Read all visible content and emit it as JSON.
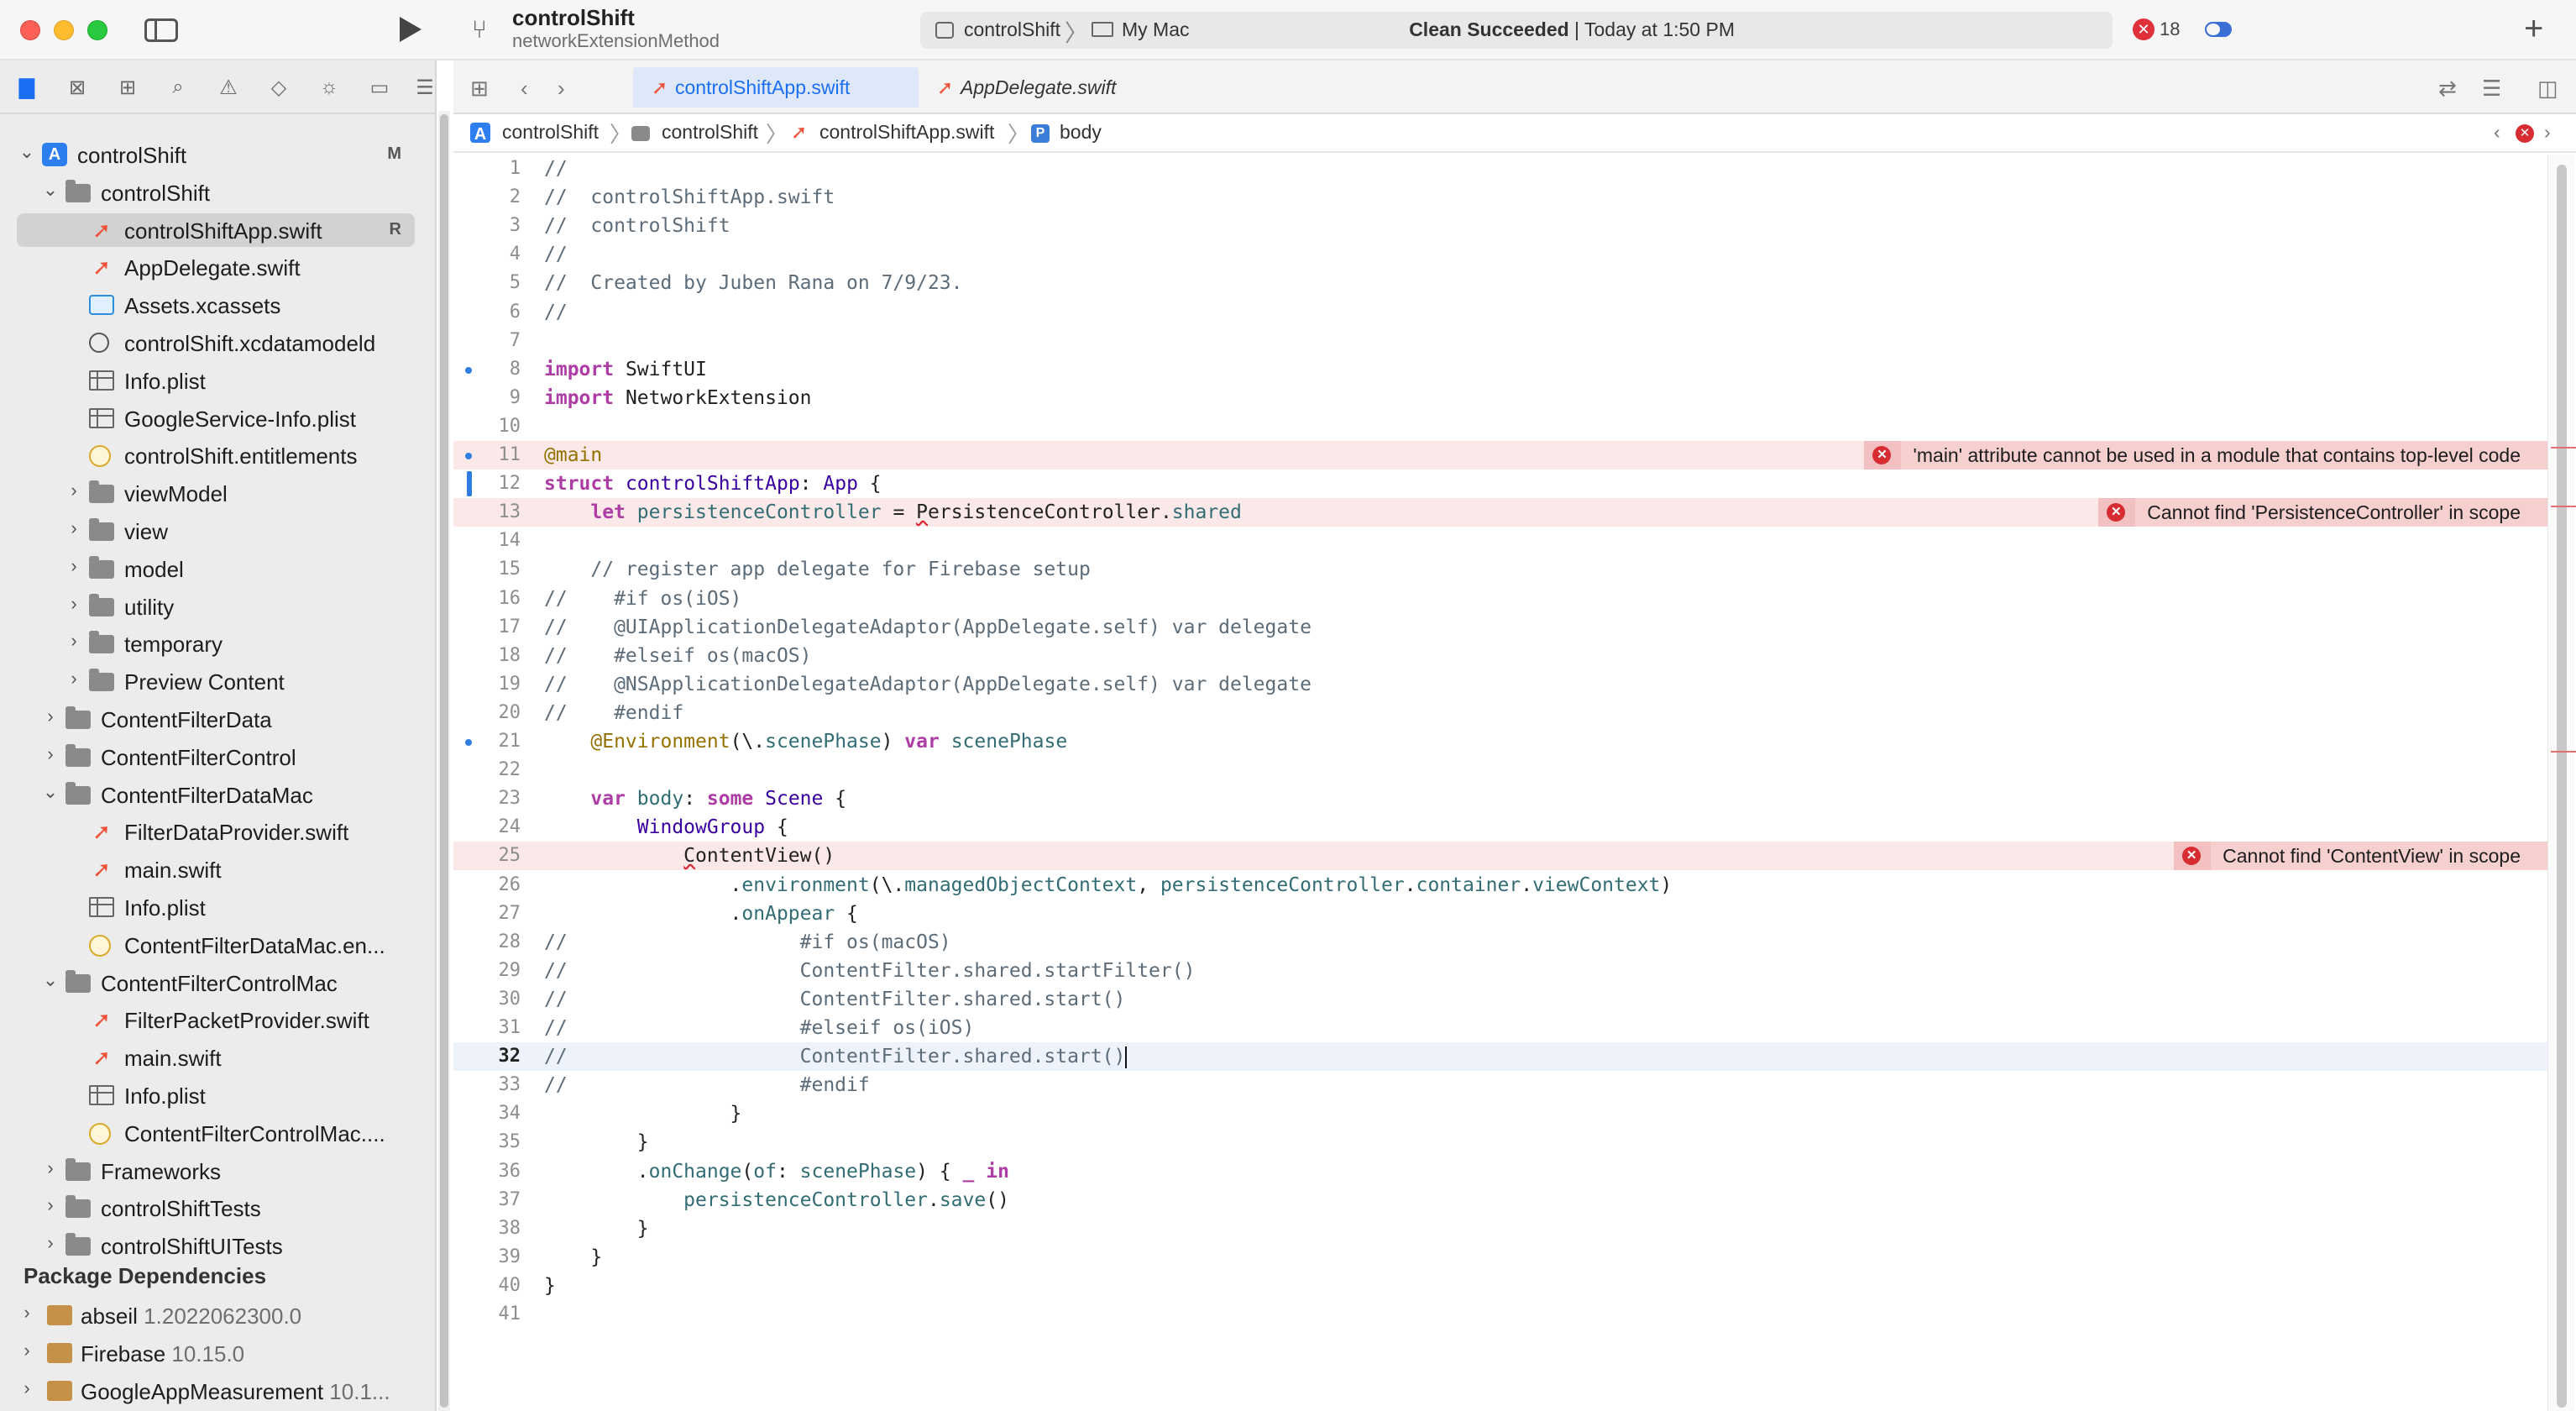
{
  "toolbar": {
    "project_title": "controlShift",
    "branch_name": "networkExtensionMethod",
    "scheme": "controlShift",
    "destination": "My Mac",
    "status_bold": "Clean Succeeded",
    "status_rest": " | Today at 1:50 PM",
    "error_count": "18",
    "icons": [
      "sidebar-icon",
      "run-icon",
      "branch-icon",
      "add-icon",
      "cloud-icon"
    ]
  },
  "sidebar": {
    "nav_icons": [
      "folder-icon",
      "source-control-icon",
      "symbol-icon",
      "search-icon",
      "issue-icon",
      "test-icon",
      "debug-icon",
      "breakpoint-icon",
      "report-icon"
    ],
    "items": [
      {
        "label": "controlShift",
        "badge": "M"
      },
      {
        "label": "controlShift"
      },
      {
        "label": "controlShiftApp.swift",
        "badge": "R"
      },
      {
        "label": "AppDelegate.swift"
      },
      {
        "label": "Assets.xcassets"
      },
      {
        "label": "controlShift.xcdatamodeld"
      },
      {
        "label": "Info.plist"
      },
      {
        "label": "GoogleService-Info.plist"
      },
      {
        "label": "controlShift.entitlements"
      },
      {
        "label": "viewModel"
      },
      {
        "label": "view"
      },
      {
        "label": "model"
      },
      {
        "label": "utility"
      },
      {
        "label": "temporary"
      },
      {
        "label": "Preview Content"
      },
      {
        "label": "ContentFilterData"
      },
      {
        "label": "ContentFilterControl"
      },
      {
        "label": "ContentFilterDataMac"
      },
      {
        "label": "FilterDataProvider.swift"
      },
      {
        "label": "main.swift"
      },
      {
        "label": "Info.plist"
      },
      {
        "label": "ContentFilterDataMac.en..."
      },
      {
        "label": "ContentFilterControlMac"
      },
      {
        "label": "FilterPacketProvider.swift"
      },
      {
        "label": "main.swift"
      },
      {
        "label": "Info.plist"
      },
      {
        "label": "ContentFilterControlMac...."
      },
      {
        "label": "Frameworks"
      },
      {
        "label": "controlShiftTests"
      },
      {
        "label": "controlShiftUITests"
      }
    ],
    "packages_title": "Package Dependencies",
    "packages": [
      {
        "name": "abseil",
        "version": "1.2022062300.0"
      },
      {
        "name": "Firebase",
        "version": "10.15.0"
      },
      {
        "name": "GoogleAppMeasurement",
        "version": "10.1..."
      }
    ]
  },
  "editor": {
    "tabs": [
      {
        "label": "controlShiftApp.swift"
      },
      {
        "label": "AppDelegate.swift"
      }
    ],
    "jumpbar": [
      "controlShift",
      "controlShift",
      "controlShiftApp.swift",
      "body"
    ],
    "jumpbar_symbol": "P",
    "errors": [
      {
        "line": 11,
        "message": "'main' attribute cannot be used in a module that contains top-level code"
      },
      {
        "line": 13,
        "message": "Cannot find 'PersistenceController' in scope"
      },
      {
        "line": 25,
        "message": "Cannot find 'ContentView' in scope"
      }
    ],
    "current_line": 32,
    "code": [
      [
        [
          "c-com",
          "//"
        ]
      ],
      [
        [
          "c-com",
          "//  controlShiftApp.swift"
        ]
      ],
      [
        [
          "c-com",
          "//  controlShift"
        ]
      ],
      [
        [
          "c-com",
          "//"
        ]
      ],
      [
        [
          "c-com",
          "//  Created by Juben Rana on 7/9/23."
        ]
      ],
      [
        [
          "c-com",
          "//"
        ]
      ],
      [],
      [
        [
          "c-kw",
          "import"
        ],
        [
          "c-plain",
          " SwiftUI"
        ]
      ],
      [
        [
          "c-kw",
          "import"
        ],
        [
          "c-plain",
          " NetworkExtension"
        ]
      ],
      [],
      [
        [
          "c-attr",
          "@main"
        ]
      ],
      [
        [
          "c-kw",
          "struct"
        ],
        [
          "c-plain",
          " "
        ],
        [
          "c-type",
          "controlShiftApp"
        ],
        [
          "c-plain",
          ": "
        ],
        [
          "c-type",
          "App"
        ],
        [
          "c-plain",
          " {"
        ]
      ],
      [
        [
          "c-plain",
          "    "
        ],
        [
          "c-kw",
          "let"
        ],
        [
          "c-plain",
          " "
        ],
        [
          "c-fn",
          "persistenceController"
        ],
        [
          "c-plain",
          " = "
        ],
        [
          "c-ul",
          "P"
        ],
        [
          "c-plain",
          "ersistenceController."
        ],
        [
          "c-prop",
          "shared"
        ]
      ],
      [],
      [
        [
          "c-plain",
          "    "
        ],
        [
          "c-com",
          "// register app delegate for Firebase setup"
        ]
      ],
      [
        [
          "c-com",
          "//    #if os(iOS)"
        ]
      ],
      [
        [
          "c-com",
          "//    @UIApplicationDelegateAdaptor(AppDelegate.self) var delegate"
        ]
      ],
      [
        [
          "c-com",
          "//    #elseif os(macOS)"
        ]
      ],
      [
        [
          "c-com",
          "//    @NSApplicationDelegateAdaptor(AppDelegate.self) var delegate"
        ]
      ],
      [
        [
          "c-com",
          "//    #endif"
        ]
      ],
      [
        [
          "c-plain",
          "    "
        ],
        [
          "c-attr",
          "@Environment"
        ],
        [
          "c-plain",
          "(\\."
        ],
        [
          "c-prop",
          "scenePhase"
        ],
        [
          "c-plain",
          ") "
        ],
        [
          "c-kw",
          "var"
        ],
        [
          "c-plain",
          " "
        ],
        [
          "c-fn",
          "scenePhase"
        ]
      ],
      [],
      [
        [
          "c-plain",
          "    "
        ],
        [
          "c-kw",
          "var"
        ],
        [
          "c-plain",
          " "
        ],
        [
          "c-fn",
          "body"
        ],
        [
          "c-plain",
          ": "
        ],
        [
          "c-kw",
          "some"
        ],
        [
          "c-plain",
          " "
        ],
        [
          "c-type",
          "Scene"
        ],
        [
          "c-plain",
          " {"
        ]
      ],
      [
        [
          "c-plain",
          "        "
        ],
        [
          "c-type",
          "WindowGroup"
        ],
        [
          "c-plain",
          " {"
        ]
      ],
      [
        [
          "c-plain",
          "            "
        ],
        [
          "c-ul",
          "C"
        ],
        [
          "c-plain",
          "ontentView()"
        ]
      ],
      [
        [
          "c-plain",
          "                ."
        ],
        [
          "c-prop",
          "environment"
        ],
        [
          "c-plain",
          "(\\."
        ],
        [
          "c-prop",
          "managedObjectContext"
        ],
        [
          "c-plain",
          ", "
        ],
        [
          "c-fn",
          "persistenceController"
        ],
        [
          "c-plain",
          "."
        ],
        [
          "c-prop",
          "container"
        ],
        [
          "c-plain",
          "."
        ],
        [
          "c-prop",
          "viewContext"
        ],
        [
          "c-plain",
          ")"
        ]
      ],
      [
        [
          "c-plain",
          "                ."
        ],
        [
          "c-prop",
          "onAppear"
        ],
        [
          "c-plain",
          " {"
        ]
      ],
      [
        [
          "c-com",
          "//                    #if os(macOS)"
        ]
      ],
      [
        [
          "c-com",
          "//                    ContentFilter.shared.startFilter()"
        ]
      ],
      [
        [
          "c-com",
          "//                    ContentFilter.shared.start()"
        ]
      ],
      [
        [
          "c-com",
          "//                    #elseif os(iOS)"
        ]
      ],
      [
        [
          "c-com",
          "//                    ContentFilter.shared.start()"
        ]
      ],
      [
        [
          "c-com",
          "//                    #endif"
        ]
      ],
      [
        [
          "c-plain",
          "                }"
        ]
      ],
      [
        [
          "c-plain",
          "        }"
        ]
      ],
      [
        [
          "c-plain",
          "        ."
        ],
        [
          "c-prop",
          "onChange"
        ],
        [
          "c-plain",
          "("
        ],
        [
          "c-prop",
          "of"
        ],
        [
          "c-plain",
          ": "
        ],
        [
          "c-fn",
          "scenePhase"
        ],
        [
          "c-plain",
          ") { "
        ],
        [
          "c-kw",
          "_"
        ],
        [
          "c-plain",
          " "
        ],
        [
          "c-kw",
          "in"
        ]
      ],
      [
        [
          "c-plain",
          "            "
        ],
        [
          "c-fn",
          "persistenceController"
        ],
        [
          "c-plain",
          "."
        ],
        [
          "c-prop",
          "save"
        ],
        [
          "c-plain",
          "()"
        ]
      ],
      [
        [
          "c-plain",
          "        }"
        ]
      ],
      [
        [
          "c-plain",
          "    }"
        ]
      ],
      [
        [
          "c-plain",
          "}"
        ]
      ],
      []
    ]
  }
}
